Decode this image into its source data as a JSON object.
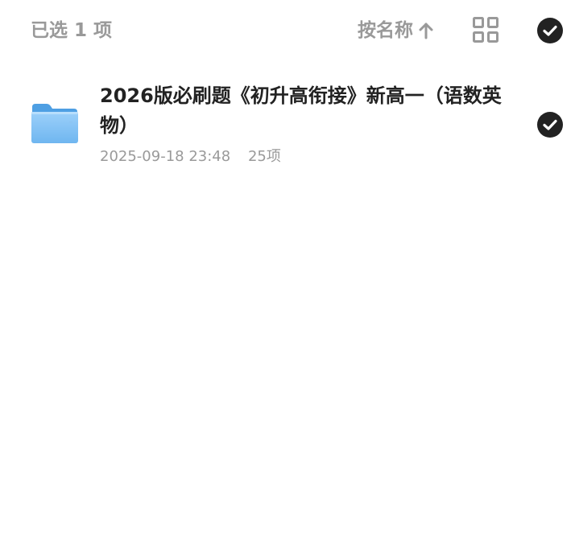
{
  "toolbar": {
    "selected_count": "已选 1 项",
    "sort_label": "按名称",
    "sort_direction_icon": "arrow-up-icon",
    "view_toggle_icon": "grid-view-icon",
    "select_all_icon": "check-circle-icon"
  },
  "files": [
    {
      "name": "2026版必刷题《初升高衔接》新高一（语数英物）",
      "modified": "2025-09-18 23:48",
      "count": "25项",
      "type_icon": "folder-icon",
      "selected": true
    }
  ],
  "colors": {
    "accent_dark": "#222222",
    "muted_text": "#999999",
    "folder_blue": "#6BB5F2"
  }
}
